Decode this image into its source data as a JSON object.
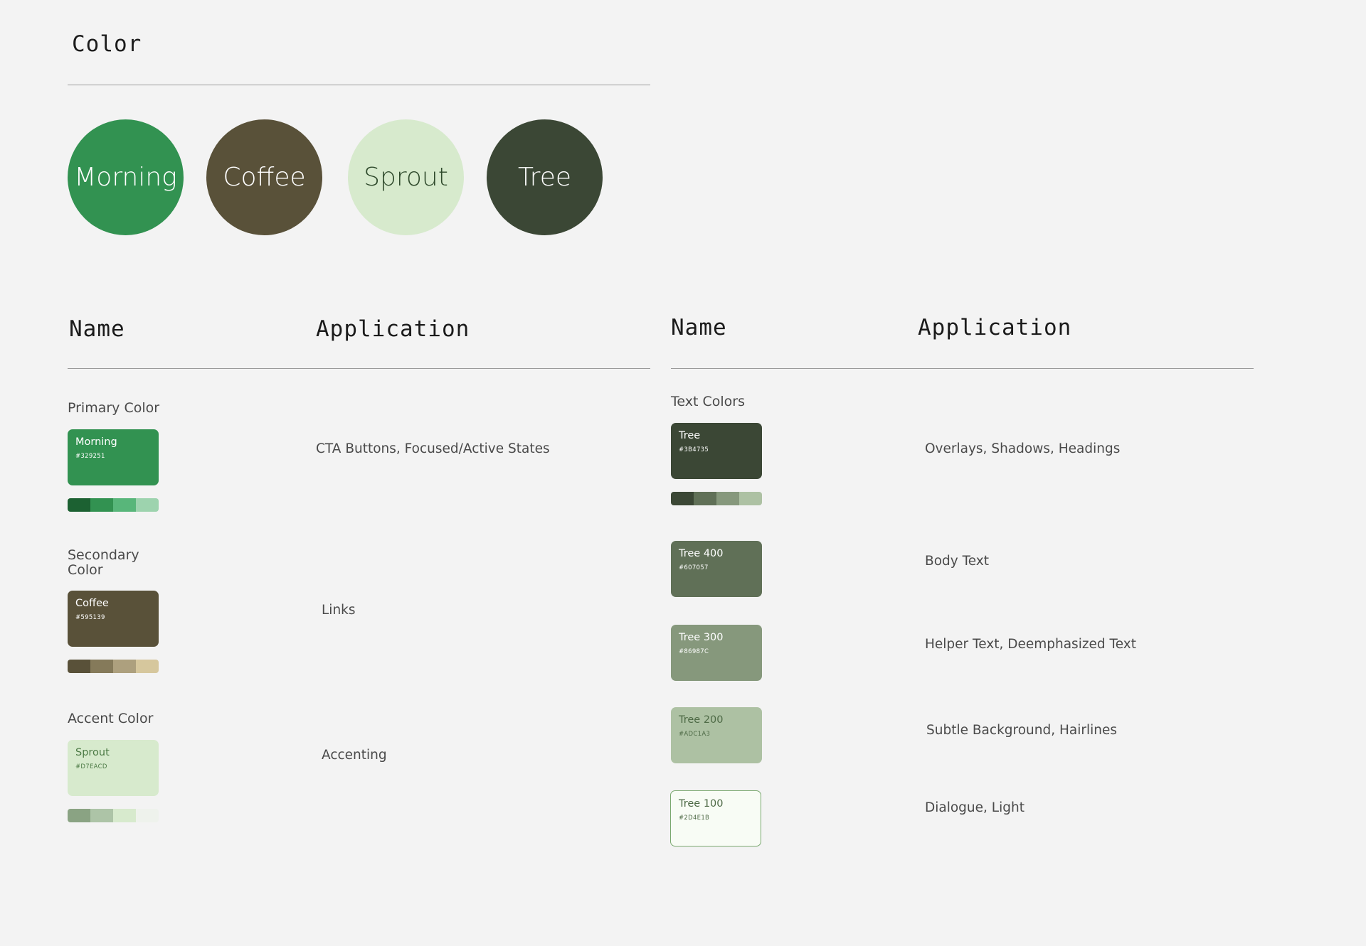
{
  "title": "Color",
  "circles": [
    {
      "label": "Morning",
      "bg": "#329251",
      "fg": "#ffffff"
    },
    {
      "label": "Coffee",
      "bg": "#595139",
      "fg": "#ffffff"
    },
    {
      "label": "Sprout",
      "bg": "#D7EACD",
      "fg": "#2f4a2c"
    },
    {
      "label": "Tree",
      "bg": "#3B4735",
      "fg": "#ffffff"
    }
  ],
  "left_table": {
    "name_header": "Name",
    "application_header": "Application",
    "groups": [
      {
        "label": "Primary Color",
        "swatch": {
          "name": "Morning",
          "hex": "#329251",
          "bg": "#329251",
          "fg": "#ffffff"
        },
        "strip": [
          "#1c6132",
          "#329251",
          "#58b67a",
          "#9dd3ae"
        ],
        "application": "CTA Buttons, Focused/Active States"
      },
      {
        "label": "Secondary Color",
        "swatch": {
          "name": "Coffee",
          "hex": "#595139",
          "bg": "#595139",
          "fg": "#ffffff"
        },
        "strip": [
          "#595139",
          "#857a5a",
          "#ada07e",
          "#d6c79d"
        ],
        "application": "Links"
      },
      {
        "label": "Accent Color",
        "swatch": {
          "name": "Sprout",
          "hex": "#D7EACD",
          "bg": "#D7EACD",
          "fg": "#4c7a45"
        },
        "strip": [
          "#8aa383",
          "#adc4a7",
          "#d7eacd",
          "#eef2ec"
        ],
        "application": "Accenting"
      }
    ]
  },
  "right_table": {
    "name_header": "Name",
    "application_header": "Application",
    "group_label": "Text Colors",
    "rows": [
      {
        "name": "Tree",
        "hex": "#3B4735",
        "bg": "#3B4735",
        "fg": "#ffffff",
        "application": "Overlays, Shadows, Headings"
      },
      {
        "name": "Tree 400",
        "hex": "#607057",
        "bg": "#607057",
        "fg": "#ffffff",
        "application": "Body Text"
      },
      {
        "name": "Tree 300",
        "hex": "#86987C",
        "bg": "#86987C",
        "fg": "#ffffff",
        "application": "Helper Text, Deemphasized Text"
      },
      {
        "name": "Tree 200",
        "hex": "#ADC1A3",
        "bg": "#ADC1A3",
        "fg": "#4e6a46",
        "application": "Subtle Background, Hairlines"
      },
      {
        "name": "Tree 100",
        "hex": "#2D4E1B",
        "bg": "#f8fcf5",
        "fg": "#4e6a46",
        "application": "Dialogue, Light"
      }
    ],
    "strip": [
      "#3b4735",
      "#607057",
      "#86987c",
      "#adc1a3"
    ]
  }
}
